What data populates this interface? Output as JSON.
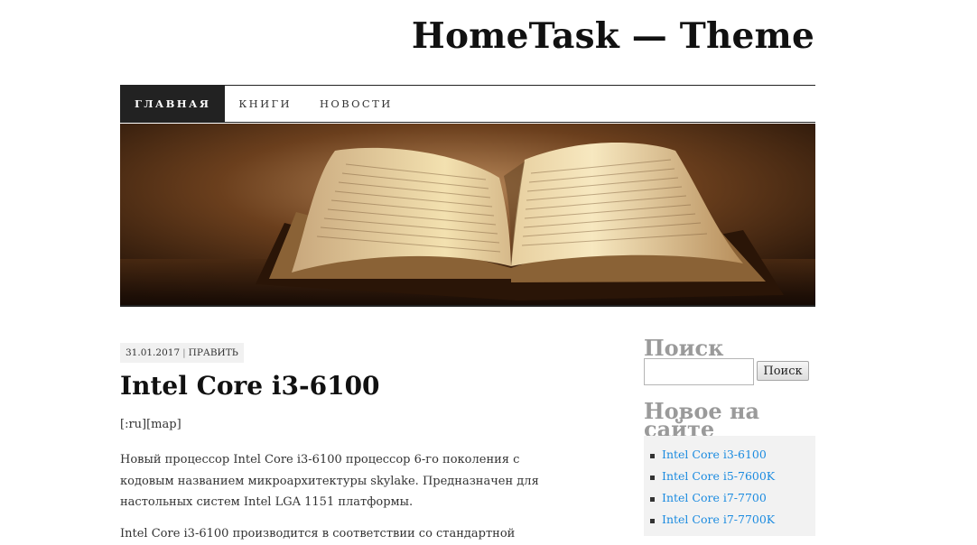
{
  "site": {
    "title": "HomeTask — Theme"
  },
  "nav": {
    "items": [
      {
        "label": "ГЛАВНАЯ",
        "active": true
      },
      {
        "label": "КНИГИ",
        "active": false
      },
      {
        "label": "НОВОСТИ",
        "active": false
      }
    ]
  },
  "post": {
    "date": "31.01.2017",
    "separator": "|",
    "edit_label": "ПРАВИТЬ",
    "title": "Intel Core i3-6100",
    "tags_line": "[:ru][map]",
    "paragraph_1": "Новый процессор Intel Core i3-6100 процессор 6-го поколения с кодовым названием микроархитектуры skylake. Предназначен для настольных систем Intel LGA 1151 платформы.",
    "paragraph_2": "Intel Core i3-6100 производится в соответствии со стандартной"
  },
  "sidebar": {
    "search": {
      "title": "Поиск",
      "input_value": "",
      "button_label": "Поиск"
    },
    "recent": {
      "title": "Новое на сайте",
      "items": [
        {
          "label": "Intel Core i3-6100"
        },
        {
          "label": "Intel Core i5-7600K"
        },
        {
          "label": "Intel Core i7-7700"
        },
        {
          "label": "Intel Core i7-7700K"
        }
      ]
    }
  },
  "colors": {
    "nav_active_bg": "#222222",
    "widget_title": "#9a9a9a",
    "link": "#1b8be0",
    "hero_dark": "#1a0d05",
    "hero_light": "#f3e1b0"
  }
}
